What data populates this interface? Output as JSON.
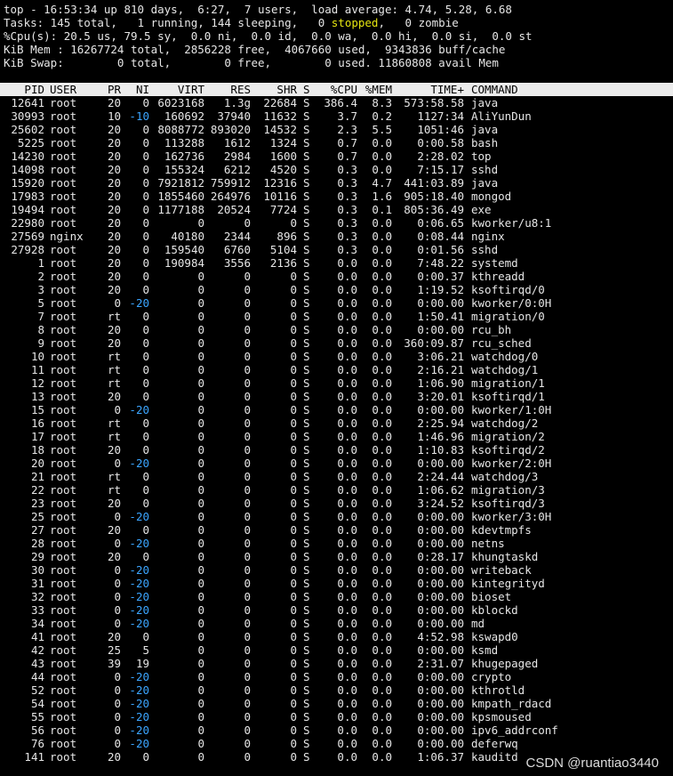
{
  "summary": {
    "uptime_line": "top - 16:53:34 up 810 days,  6:27,  7 users,  load average: 4.74, 5.28, 6.68",
    "tasks_prefix": "Tasks: 145 total,   1 running, 144 sleeping,   0 ",
    "tasks_stopped": "stopped",
    "tasks_suffix": ",   0 zombie",
    "cpu_line": "%Cpu(s): 20.5 us, 79.5 sy,  0.0 ni,  0.0 id,  0.0 wa,  0.0 hi,  0.0 si,  0.0 st",
    "mem_line": "KiB Mem : 16267724 total,  2856228 free,  4067660 used,  9343836 buff/cache",
    "swap_line": "KiB Swap:        0 total,        0 free,        0 used. 11860808 avail Mem"
  },
  "columns": {
    "pid": "PID",
    "user": "USER",
    "pr": "PR",
    "ni": "NI",
    "virt": "VIRT",
    "res": "RES",
    "shr": "SHR",
    "s": "S",
    "cpu": "%CPU",
    "mem": "%MEM",
    "time": "TIME+",
    "command": "COMMAND"
  },
  "processes": [
    [
      "12641",
      "root",
      "20",
      "0",
      "6023168",
      "1.3g",
      "22684",
      "S",
      "386.4",
      "8.3",
      "573:58.58",
      "java"
    ],
    [
      "30993",
      "root",
      "10",
      "-10",
      "160692",
      "37940",
      "11632",
      "S",
      "3.7",
      "0.2",
      "1127:34",
      "AliYunDun"
    ],
    [
      "25602",
      "root",
      "20",
      "0",
      "8088772",
      "893020",
      "14532",
      "S",
      "2.3",
      "5.5",
      "1051:46",
      "java"
    ],
    [
      "5225",
      "root",
      "20",
      "0",
      "113288",
      "1612",
      "1324",
      "S",
      "0.7",
      "0.0",
      "0:00.58",
      "bash"
    ],
    [
      "14230",
      "root",
      "20",
      "0",
      "162736",
      "2984",
      "1600",
      "S",
      "0.7",
      "0.0",
      "2:28.02",
      "top"
    ],
    [
      "14098",
      "root",
      "20",
      "0",
      "155324",
      "6212",
      "4520",
      "S",
      "0.3",
      "0.0",
      "7:15.17",
      "sshd"
    ],
    [
      "15920",
      "root",
      "20",
      "0",
      "7921812",
      "759912",
      "12316",
      "S",
      "0.3",
      "4.7",
      "441:03.89",
      "java"
    ],
    [
      "17983",
      "root",
      "20",
      "0",
      "1855460",
      "264976",
      "10116",
      "S",
      "0.3",
      "1.6",
      "905:18.40",
      "mongod"
    ],
    [
      "19494",
      "root",
      "20",
      "0",
      "1177188",
      "20524",
      "7724",
      "S",
      "0.3",
      "0.1",
      "805:36.49",
      "exe"
    ],
    [
      "22980",
      "root",
      "20",
      "0",
      "0",
      "0",
      "0",
      "S",
      "0.3",
      "0.0",
      "0:06.65",
      "kworker/u8:1"
    ],
    [
      "27569",
      "nginx",
      "20",
      "0",
      "40180",
      "2344",
      "896",
      "S",
      "0.3",
      "0.0",
      "0:08.44",
      "nginx"
    ],
    [
      "27928",
      "root",
      "20",
      "0",
      "159540",
      "6760",
      "5104",
      "S",
      "0.3",
      "0.0",
      "0:01.56",
      "sshd"
    ],
    [
      "1",
      "root",
      "20",
      "0",
      "190984",
      "3556",
      "2136",
      "S",
      "0.0",
      "0.0",
      "7:48.22",
      "systemd"
    ],
    [
      "2",
      "root",
      "20",
      "0",
      "0",
      "0",
      "0",
      "S",
      "0.0",
      "0.0",
      "0:00.37",
      "kthreadd"
    ],
    [
      "3",
      "root",
      "20",
      "0",
      "0",
      "0",
      "0",
      "S",
      "0.0",
      "0.0",
      "1:19.52",
      "ksoftirqd/0"
    ],
    [
      "5",
      "root",
      "0",
      "-20",
      "0",
      "0",
      "0",
      "S",
      "0.0",
      "0.0",
      "0:00.00",
      "kworker/0:0H"
    ],
    [
      "7",
      "root",
      "rt",
      "0",
      "0",
      "0",
      "0",
      "S",
      "0.0",
      "0.0",
      "1:50.41",
      "migration/0"
    ],
    [
      "8",
      "root",
      "20",
      "0",
      "0",
      "0",
      "0",
      "S",
      "0.0",
      "0.0",
      "0:00.00",
      "rcu_bh"
    ],
    [
      "9",
      "root",
      "20",
      "0",
      "0",
      "0",
      "0",
      "S",
      "0.0",
      "0.0",
      "360:09.87",
      "rcu_sched"
    ],
    [
      "10",
      "root",
      "rt",
      "0",
      "0",
      "0",
      "0",
      "S",
      "0.0",
      "0.0",
      "3:06.21",
      "watchdog/0"
    ],
    [
      "11",
      "root",
      "rt",
      "0",
      "0",
      "0",
      "0",
      "S",
      "0.0",
      "0.0",
      "2:16.21",
      "watchdog/1"
    ],
    [
      "12",
      "root",
      "rt",
      "0",
      "0",
      "0",
      "0",
      "S",
      "0.0",
      "0.0",
      "1:06.90",
      "migration/1"
    ],
    [
      "13",
      "root",
      "20",
      "0",
      "0",
      "0",
      "0",
      "S",
      "0.0",
      "0.0",
      "3:20.01",
      "ksoftirqd/1"
    ],
    [
      "15",
      "root",
      "0",
      "-20",
      "0",
      "0",
      "0",
      "S",
      "0.0",
      "0.0",
      "0:00.00",
      "kworker/1:0H"
    ],
    [
      "16",
      "root",
      "rt",
      "0",
      "0",
      "0",
      "0",
      "S",
      "0.0",
      "0.0",
      "2:25.94",
      "watchdog/2"
    ],
    [
      "17",
      "root",
      "rt",
      "0",
      "0",
      "0",
      "0",
      "S",
      "0.0",
      "0.0",
      "1:46.96",
      "migration/2"
    ],
    [
      "18",
      "root",
      "20",
      "0",
      "0",
      "0",
      "0",
      "S",
      "0.0",
      "0.0",
      "1:10.83",
      "ksoftirqd/2"
    ],
    [
      "20",
      "root",
      "0",
      "-20",
      "0",
      "0",
      "0",
      "S",
      "0.0",
      "0.0",
      "0:00.00",
      "kworker/2:0H"
    ],
    [
      "21",
      "root",
      "rt",
      "0",
      "0",
      "0",
      "0",
      "S",
      "0.0",
      "0.0",
      "2:24.44",
      "watchdog/3"
    ],
    [
      "22",
      "root",
      "rt",
      "0",
      "0",
      "0",
      "0",
      "S",
      "0.0",
      "0.0",
      "1:06.62",
      "migration/3"
    ],
    [
      "23",
      "root",
      "20",
      "0",
      "0",
      "0",
      "0",
      "S",
      "0.0",
      "0.0",
      "3:24.52",
      "ksoftirqd/3"
    ],
    [
      "25",
      "root",
      "0",
      "-20",
      "0",
      "0",
      "0",
      "S",
      "0.0",
      "0.0",
      "0:00.00",
      "kworker/3:0H"
    ],
    [
      "27",
      "root",
      "20",
      "0",
      "0",
      "0",
      "0",
      "S",
      "0.0",
      "0.0",
      "0:00.00",
      "kdevtmpfs"
    ],
    [
      "28",
      "root",
      "0",
      "-20",
      "0",
      "0",
      "0",
      "S",
      "0.0",
      "0.0",
      "0:00.00",
      "netns"
    ],
    [
      "29",
      "root",
      "20",
      "0",
      "0",
      "0",
      "0",
      "S",
      "0.0",
      "0.0",
      "0:28.17",
      "khungtaskd"
    ],
    [
      "30",
      "root",
      "0",
      "-20",
      "0",
      "0",
      "0",
      "S",
      "0.0",
      "0.0",
      "0:00.00",
      "writeback"
    ],
    [
      "31",
      "root",
      "0",
      "-20",
      "0",
      "0",
      "0",
      "S",
      "0.0",
      "0.0",
      "0:00.00",
      "kintegrityd"
    ],
    [
      "32",
      "root",
      "0",
      "-20",
      "0",
      "0",
      "0",
      "S",
      "0.0",
      "0.0",
      "0:00.00",
      "bioset"
    ],
    [
      "33",
      "root",
      "0",
      "-20",
      "0",
      "0",
      "0",
      "S",
      "0.0",
      "0.0",
      "0:00.00",
      "kblockd"
    ],
    [
      "34",
      "root",
      "0",
      "-20",
      "0",
      "0",
      "0",
      "S",
      "0.0",
      "0.0",
      "0:00.00",
      "md"
    ],
    [
      "41",
      "root",
      "20",
      "0",
      "0",
      "0",
      "0",
      "S",
      "0.0",
      "0.0",
      "4:52.98",
      "kswapd0"
    ],
    [
      "42",
      "root",
      "25",
      "5",
      "0",
      "0",
      "0",
      "S",
      "0.0",
      "0.0",
      "0:00.00",
      "ksmd"
    ],
    [
      "43",
      "root",
      "39",
      "19",
      "0",
      "0",
      "0",
      "S",
      "0.0",
      "0.0",
      "2:31.07",
      "khugepaged"
    ],
    [
      "44",
      "root",
      "0",
      "-20",
      "0",
      "0",
      "0",
      "S",
      "0.0",
      "0.0",
      "0:00.00",
      "crypto"
    ],
    [
      "52",
      "root",
      "0",
      "-20",
      "0",
      "0",
      "0",
      "S",
      "0.0",
      "0.0",
      "0:00.00",
      "kthrotld"
    ],
    [
      "54",
      "root",
      "0",
      "-20",
      "0",
      "0",
      "0",
      "S",
      "0.0",
      "0.0",
      "0:00.00",
      "kmpath_rdacd"
    ],
    [
      "55",
      "root",
      "0",
      "-20",
      "0",
      "0",
      "0",
      "S",
      "0.0",
      "0.0",
      "0:00.00",
      "kpsmoused"
    ],
    [
      "56",
      "root",
      "0",
      "-20",
      "0",
      "0",
      "0",
      "S",
      "0.0",
      "0.0",
      "0:00.00",
      "ipv6_addrconf"
    ],
    [
      "76",
      "root",
      "0",
      "-20",
      "0",
      "0",
      "0",
      "S",
      "0.0",
      "0.0",
      "0:00.00",
      "deferwq"
    ],
    [
      "141",
      "root",
      "20",
      "0",
      "0",
      "0",
      "0",
      "S",
      "0.0",
      "0.0",
      "1:06.37",
      "kauditd"
    ]
  ],
  "watermark": "CSDN @ruantiao3440",
  "colors": {
    "background": "#000000",
    "text": "#e6e6e6",
    "stopped": "#e5e510",
    "negative_nice": "#3ba5ff",
    "header_bg": "#ececec"
  }
}
